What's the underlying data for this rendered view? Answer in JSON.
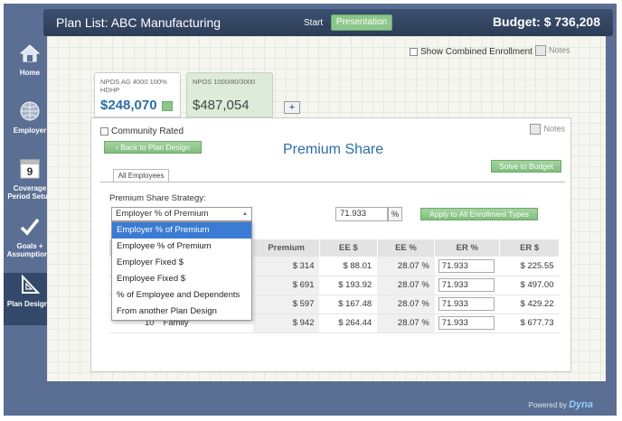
{
  "header": {
    "title": "Plan List: ABC Manufacturing",
    "start": "Start",
    "presentation": "Presentation",
    "budget": "Budget: $ 736,208"
  },
  "sidebar": {
    "items": [
      {
        "label": "Home",
        "icon": "home-icon"
      },
      {
        "label": "Employer",
        "icon": "globe-icon"
      },
      {
        "label": "Coverage Period Setup",
        "icon": "calendar-icon",
        "calendar_day": "9"
      },
      {
        "label": "Goals + Assumptions",
        "icon": "check-icon"
      },
      {
        "label": "Plan Designs",
        "icon": "plan-designs-icon",
        "active": true
      }
    ]
  },
  "top": {
    "combined_label": "Show Combined Enrollment",
    "notes": "Notes"
  },
  "plans": [
    {
      "name": "NPOS AG 4000 100% HDHP",
      "value": "$248,070"
    },
    {
      "name": "NPOS 1000/80/3000",
      "value": "$487,054"
    }
  ],
  "add_plan": "+",
  "panel": {
    "community_rated": "Community Rated",
    "notes": "Notes",
    "back_button": "‹  Back to Plan Design",
    "title": "Premium Share",
    "solve_button": "Solve to Budget",
    "tab": "All Employees",
    "strategy_label": "Premium Share Strategy:",
    "strategy_selected": "Employer % of Premium",
    "pct_value": "71.933",
    "pct_symbol": "%",
    "apply_button": "Apply to All Enrollment Types"
  },
  "dropdown_options": [
    "Employer % of Premium",
    "Employee % of Premium",
    "Employer Fixed $",
    "Employee Fixed $",
    "% of Employee and Dependents",
    "From another Plan Design"
  ],
  "table": {
    "headers": [
      "",
      "",
      "Premium",
      "EE $",
      "EE %",
      "ER %",
      "ER $"
    ],
    "rows": [
      {
        "count": "",
        "tier": "",
        "premium": "$ 314",
        "ee_dollar": "$ 88.01",
        "ee_pct": "28.07 %",
        "er_pct": "71.933",
        "er_dollar": "$ 225.55"
      },
      {
        "count": "",
        "tier": "",
        "premium": "$ 691",
        "ee_dollar": "$ 193.92",
        "ee_pct": "28.07 %",
        "er_pct": "71.933",
        "er_dollar": "$ 497.00"
      },
      {
        "count": "",
        "tier": "",
        "premium": "$ 597",
        "ee_dollar": "$ 167.48",
        "ee_pct": "28.07 %",
        "er_pct": "71.933",
        "er_dollar": "$ 429.22"
      },
      {
        "count": "10",
        "tier": "Family",
        "premium": "$ 942",
        "ee_dollar": "$ 264.44",
        "ee_pct": "28.07 %",
        "er_pct": "71.933",
        "er_dollar": "$ 677.73"
      }
    ]
  },
  "footer": {
    "powered_by": "Powered by",
    "brand": "Dyna"
  },
  "colors": {
    "accent_blue": "#2b6ea8",
    "button_green": "#8cc68a",
    "header_navy": "#2d3d57",
    "selection_blue": "#3b7bd3"
  }
}
